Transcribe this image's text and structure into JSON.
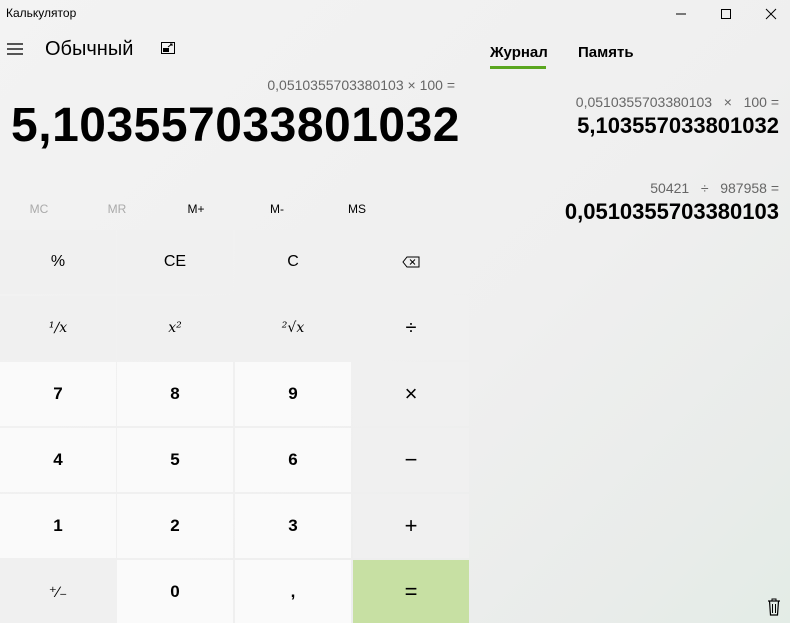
{
  "window": {
    "title": "Калькулятор",
    "minimize_icon": "minimize-icon",
    "maximize_icon": "maximize-icon",
    "close_icon": "close-icon"
  },
  "header": {
    "menu_icon": "hamburger-menu-icon",
    "mode": "Обычный",
    "keep_on_top_icon": "keep-on-top-icon"
  },
  "display": {
    "expression": "0,0510355703380103 × 100 =",
    "result": "5,103557033801032"
  },
  "memory": {
    "buttons": [
      {
        "label": "MC",
        "enabled": false
      },
      {
        "label": "MR",
        "enabled": false
      },
      {
        "label": "M+",
        "enabled": true
      },
      {
        "label": "M-",
        "enabled": true
      },
      {
        "label": "MS",
        "enabled": true
      }
    ]
  },
  "keypad": {
    "rows": [
      [
        {
          "label": "%",
          "kind": "fn"
        },
        {
          "label": "CE",
          "kind": "fn"
        },
        {
          "label": "C",
          "kind": "fn"
        },
        {
          "label": "⌫",
          "kind": "fn",
          "icon": "backspace-icon"
        }
      ],
      [
        {
          "label": "¹∕x",
          "kind": "fn"
        },
        {
          "label": "x²",
          "kind": "fn"
        },
        {
          "label": "²√x",
          "kind": "fn"
        },
        {
          "label": "÷",
          "kind": "fn"
        }
      ],
      [
        {
          "label": "7",
          "kind": "num"
        },
        {
          "label": "8",
          "kind": "num"
        },
        {
          "label": "9",
          "kind": "num"
        },
        {
          "label": "×",
          "kind": "fn"
        }
      ],
      [
        {
          "label": "4",
          "kind": "num"
        },
        {
          "label": "5",
          "kind": "num"
        },
        {
          "label": "6",
          "kind": "num"
        },
        {
          "label": "−",
          "kind": "fn"
        }
      ],
      [
        {
          "label": "1",
          "kind": "num"
        },
        {
          "label": "2",
          "kind": "num"
        },
        {
          "label": "3",
          "kind": "num"
        },
        {
          "label": "+",
          "kind": "fn"
        }
      ],
      [
        {
          "label": "⁺∕₋",
          "kind": "fn"
        },
        {
          "label": "0",
          "kind": "num"
        },
        {
          "label": ",",
          "kind": "num"
        },
        {
          "label": "=",
          "kind": "eq"
        }
      ]
    ]
  },
  "side_panel": {
    "tabs": [
      {
        "label": "Журнал",
        "active": true
      },
      {
        "label": "Память",
        "active": false
      }
    ],
    "history": [
      {
        "expression": "0,0510355703380103   ×   100 =",
        "result": "5,103557033801032"
      },
      {
        "expression": "50421   ÷   987958 =",
        "result": "0,0510355703380103"
      }
    ],
    "clear_icon": "trash-icon"
  },
  "colors": {
    "accent": "#5aa61f",
    "equals_bg": "#c7e0a3",
    "function_key_bg": "#f0f0f0",
    "number_key_bg": "#fafafa",
    "background": "#f3f3f3"
  }
}
